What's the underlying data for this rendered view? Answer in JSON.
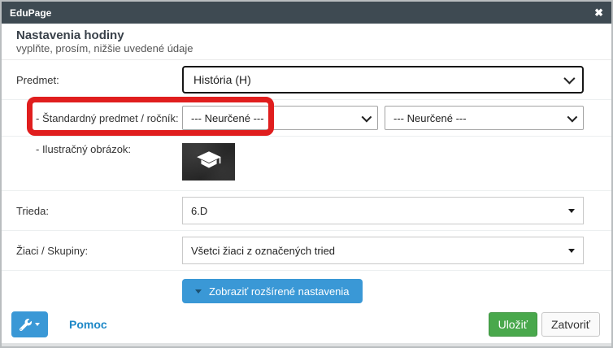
{
  "titlebar": {
    "title": "EduPage",
    "close_glyph": "✖"
  },
  "intro": {
    "heading": "Nastavenia hodiny",
    "subheading": "vyplňte, prosím, nižšie uvedené údaje"
  },
  "form": {
    "predmet": {
      "label": "Predmet:",
      "value": "História (H)"
    },
    "standard": {
      "label": "- Štandardný predmet / ročník:",
      "subject_value": "--- Neurčené ---",
      "grade_value": "--- Neurčené ---"
    },
    "image": {
      "label": "- Ilustračný obrázok:",
      "icon": "graduation-cap"
    },
    "trieda": {
      "label": "Trieda:",
      "value": "6.D"
    },
    "ziaci": {
      "label": "Žiaci / Skupiny:",
      "value": "Všetci žiaci z označených tried"
    }
  },
  "actions": {
    "advanced_label": "Zobraziť rozšírené nastavenia",
    "help_label": "Pomoc",
    "save_label": "Uložiť",
    "close_label": "Zatvoriť"
  },
  "colors": {
    "titlebar_bg": "#3e4a52",
    "accent_blue": "#3a98d6",
    "link_blue": "#1e88c7",
    "save_green": "#49a84c",
    "highlight_red": "#e01e1e",
    "select_focus_border": "#161616"
  }
}
